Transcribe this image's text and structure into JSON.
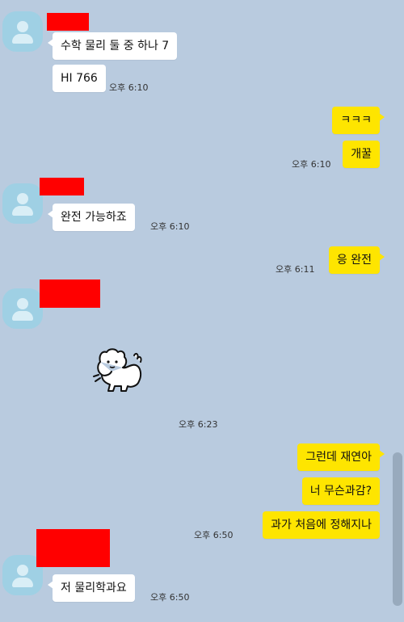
{
  "messages": {
    "m1": {
      "text": "수학 물리 둘 중 하나 7"
    },
    "m2": {
      "text": "HI 766",
      "time": "오후 6:10"
    },
    "m3": {
      "text": "ㅋㅋㅋ"
    },
    "m4": {
      "text": "개꿀",
      "time": "오후 6:10"
    },
    "m5": {
      "text": "완전 가능하죠",
      "time": "오후 6:10"
    },
    "m6": {
      "text": "응 완전",
      "time": "오후 6:11"
    },
    "sticker": {
      "time": "오후 6:23",
      "icon": "puppy-sticker"
    },
    "m7": {
      "text": "그런데 재연아"
    },
    "m8": {
      "text": "너 무슨과감?"
    },
    "m9": {
      "text": "과가 처음에 정해지나",
      "time": "오후 6:50"
    },
    "m10": {
      "text": "저 물리학과요",
      "time": "오후 6:50"
    }
  },
  "colors": {
    "background": "#b9cbdf",
    "my_bubble": "#fee500",
    "other_bubble": "#ffffff",
    "avatar": "#9fd0e4",
    "redaction": "#ff0000"
  }
}
